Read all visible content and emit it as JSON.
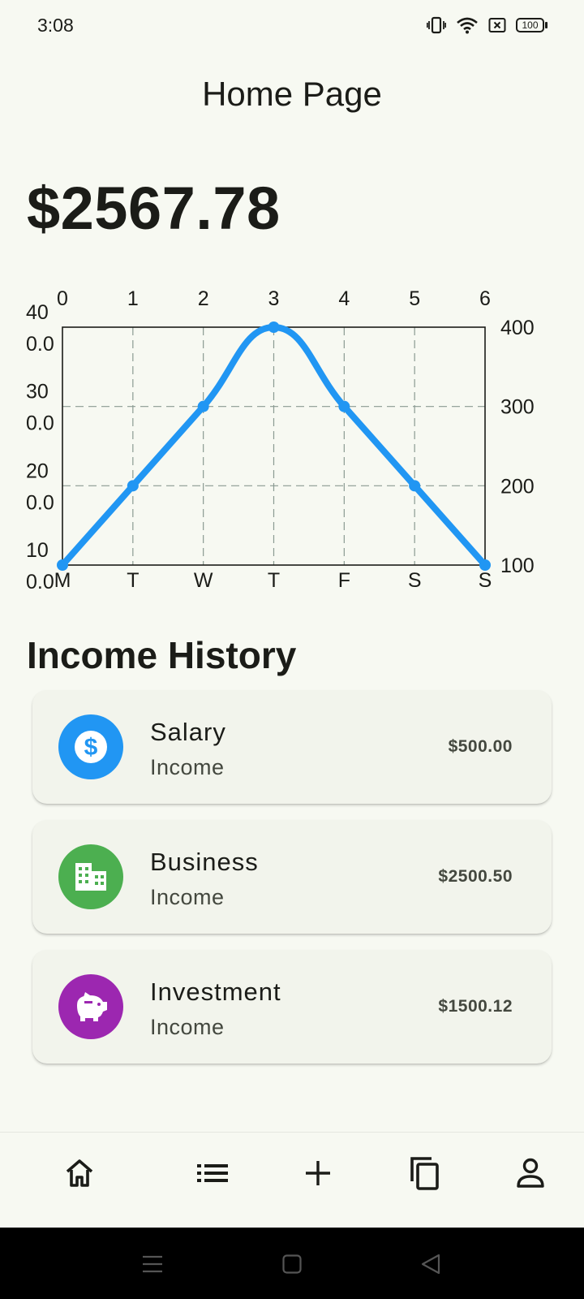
{
  "status_bar": {
    "time": "3:08",
    "battery": "100",
    "icons": [
      "vibrate-icon",
      "wifi-icon",
      "no-sim-icon",
      "battery-icon"
    ]
  },
  "app_bar": {
    "title": "Home Page"
  },
  "balance": {
    "amount": "$2567.78"
  },
  "chart_data": {
    "type": "line",
    "x": [
      0,
      1,
      2,
      3,
      4,
      5,
      6
    ],
    "categories": [
      "M",
      "T",
      "W",
      "T",
      "F",
      "S",
      "S"
    ],
    "top_tick_labels": [
      "0",
      "1",
      "2",
      "3",
      "4",
      "5",
      "6"
    ],
    "left_tick_labels": [
      [
        "40",
        "0.0"
      ],
      [
        "30",
        "0.0"
      ],
      [
        "20",
        "0.0"
      ],
      [
        "10",
        "0.0"
      ]
    ],
    "right_tick_labels": [
      "400",
      "300",
      "200",
      "100"
    ],
    "series": [
      {
        "values": [
          100,
          200,
          300,
          400,
          300,
          200,
          100
        ],
        "color": "#2196f3"
      }
    ],
    "ylim": [
      100,
      400
    ],
    "xlim": [
      0,
      6
    ],
    "grid": true,
    "curve": "smooth",
    "dots": true
  },
  "income_history": {
    "title": "Income History",
    "items": [
      {
        "title": "Salary",
        "subtitle": "Income",
        "amount": "$500.00",
        "icon": "dollar-icon",
        "color": "#2196f3"
      },
      {
        "title": "Business",
        "subtitle": "Income",
        "amount": "$2500.50",
        "icon": "building-icon",
        "color": "#4caf50"
      },
      {
        "title": "Investment",
        "subtitle": "Income",
        "amount": "$1500.12",
        "icon": "piggy-bank-icon",
        "color": "#9c27b0"
      }
    ]
  },
  "bottom_nav": {
    "items": [
      "home-icon",
      "list-icon",
      "add-icon",
      "copy-icon",
      "profile-icon"
    ],
    "active": "home-icon"
  },
  "system_nav": {
    "items": [
      "menu-icon",
      "home-square-icon",
      "back-triangle-icon"
    ]
  }
}
